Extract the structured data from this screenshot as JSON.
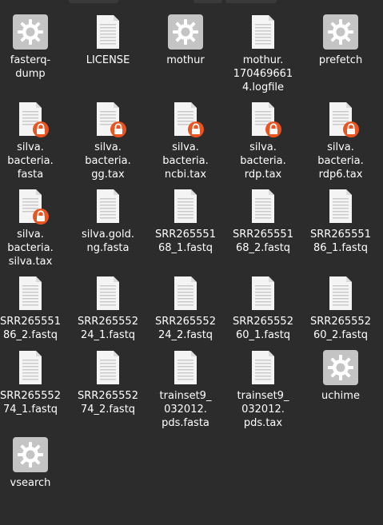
{
  "files": [
    {
      "name": "fasterq-\ndump",
      "icon": "executable-icon"
    },
    {
      "name": "LICENSE",
      "icon": "document-icon"
    },
    {
      "name": "mothur",
      "icon": "executable-icon"
    },
    {
      "name": "mothur.\n170469661\n4.logfile",
      "icon": "document-icon"
    },
    {
      "name": "prefetch",
      "icon": "executable-icon"
    },
    {
      "name": "silva.\nbacteria.\nfasta",
      "icon": "locked-document-icon"
    },
    {
      "name": "silva.\nbacteria.\ngg.tax",
      "icon": "locked-document-icon"
    },
    {
      "name": "silva.\nbacteria.\nncbi.tax",
      "icon": "locked-document-icon"
    },
    {
      "name": "silva.\nbacteria.\nrdp.tax",
      "icon": "locked-document-icon"
    },
    {
      "name": "silva.\nbacteria.\nrdp6.tax",
      "icon": "locked-document-icon"
    },
    {
      "name": "silva.\nbacteria.\nsilva.tax",
      "icon": "locked-document-icon"
    },
    {
      "name": "silva.gold.\nng.fasta",
      "icon": "document-icon"
    },
    {
      "name": "SRR265551\n68_1.fastq",
      "icon": "document-icon"
    },
    {
      "name": "SRR265551\n68_2.fastq",
      "icon": "document-icon"
    },
    {
      "name": "SRR265551\n86_1.fastq",
      "icon": "document-icon"
    },
    {
      "name": "SRR265551\n86_2.fastq",
      "icon": "document-icon"
    },
    {
      "name": "SRR265552\n24_1.fastq",
      "icon": "document-icon"
    },
    {
      "name": "SRR265552\n24_2.fastq",
      "icon": "document-icon"
    },
    {
      "name": "SRR265552\n60_1.fastq",
      "icon": "document-icon"
    },
    {
      "name": "SRR265552\n60_2.fastq",
      "icon": "document-icon"
    },
    {
      "name": "SRR265552\n74_1.fastq",
      "icon": "document-icon"
    },
    {
      "name": "SRR265552\n74_2.fastq",
      "icon": "document-icon"
    },
    {
      "name": "trainset9_\n032012.\npds.fasta",
      "icon": "document-icon"
    },
    {
      "name": "trainset9_\n032012.\npds.tax",
      "icon": "document-icon"
    },
    {
      "name": "uchime",
      "icon": "executable-icon"
    },
    {
      "name": "vsearch",
      "icon": "executable-icon"
    }
  ],
  "colors": {
    "background": "#2c2c2c",
    "label_text": "#ffffff",
    "document_fill": "#f4f4f4",
    "document_lines": "#c8c8c8",
    "executable_fill": "#c4c4c4",
    "gear": "#ffffff",
    "lock_badge": "#e95420"
  }
}
